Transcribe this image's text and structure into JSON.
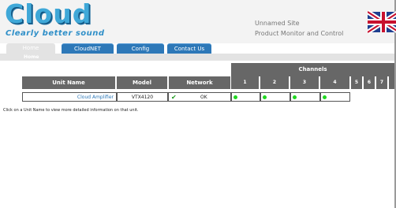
{
  "brand": {
    "logo_text": "Cloud",
    "tagline": "Clearly better sound"
  },
  "site": {
    "name": "Unnamed Site",
    "subtitle": "Product Monitor and Control"
  },
  "tabs": [
    {
      "label": "Home",
      "active": true
    },
    {
      "label": "CloudNET",
      "active": false
    },
    {
      "label": "Config",
      "active": false
    },
    {
      "label": "Contact Us",
      "active": false
    }
  ],
  "breadcrumb": "Home",
  "table": {
    "headers": {
      "unit_name": "Unit Name",
      "model": "Model",
      "network": "Network",
      "channels": "Channels"
    },
    "channel_numbers": [
      "1",
      "2",
      "3",
      "4",
      "5",
      "6",
      "7"
    ],
    "rows": [
      {
        "unit_name": "Cloud Amplifier",
        "model": "VTX4120",
        "network_status": "OK",
        "channels_ok": [
          true,
          true,
          true,
          true
        ]
      }
    ]
  },
  "note": "Click on a Unit Name to view more detailed information on that unit.",
  "colors": {
    "brand_blue": "#3fa8d8",
    "tab_blue": "#2d78b8",
    "header_gray": "#676767",
    "status_green": "#22d622"
  }
}
